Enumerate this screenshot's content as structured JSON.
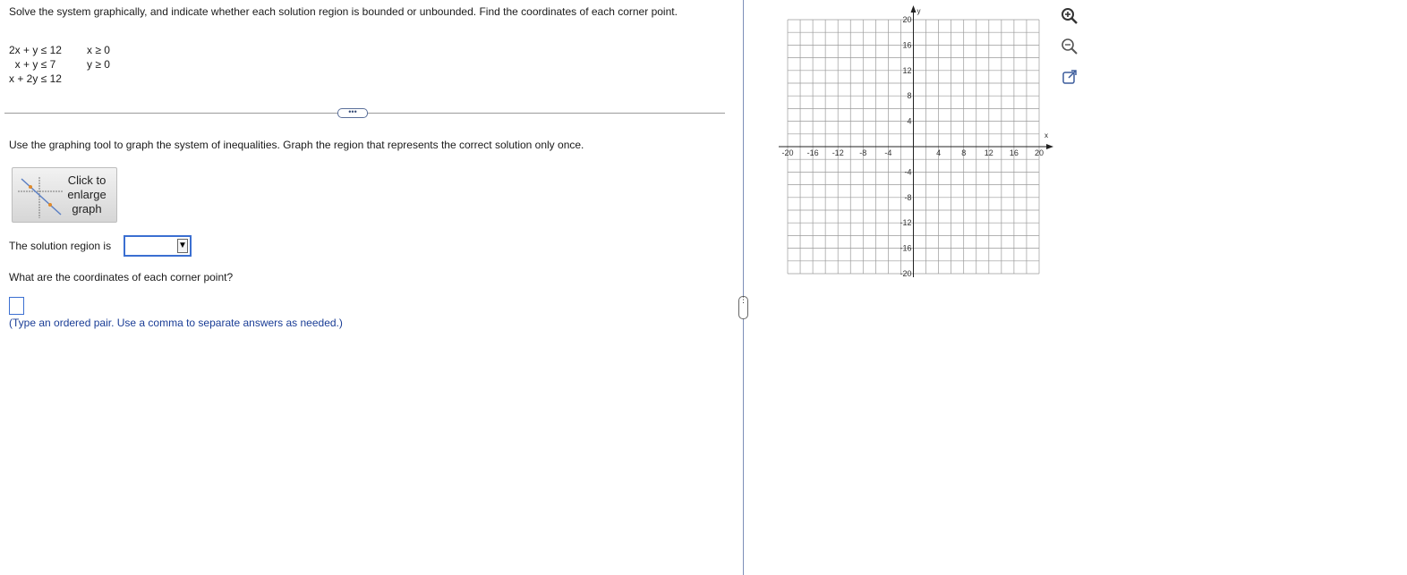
{
  "problem": {
    "prompt": "Solve the system graphically, and indicate whether each solution region is bounded or unbounded. Find the coordinates of each corner point.",
    "inequalities_left": [
      "2x + y ≤ 12",
      "x + y ≤ 7",
      "x + 2y ≤ 12"
    ],
    "inequalities_right": [
      "x ≥ 0",
      "y ≥ 0"
    ]
  },
  "toolbar": {
    "more_label": "•••"
  },
  "instructions": "Use the graphing tool to graph the system of inequalities. Graph the region that represents the correct solution only once.",
  "enlarge_button": {
    "line1": "Click to",
    "line2": "enlarge",
    "line3": "graph"
  },
  "solution_region": {
    "label": "The solution region is",
    "selected": ""
  },
  "corner_points": {
    "question": "What are the coordinates of each corner point?",
    "answer": "",
    "hint": "(Type an ordered pair. Use a comma to separate answers as needed.)"
  },
  "pane_handle": "⋮",
  "graph": {
    "x_label": "x",
    "y_label": "y",
    "x_ticks": [
      "-20",
      "-16",
      "-12",
      "-8",
      "-4",
      "4",
      "8",
      "12",
      "16",
      "20"
    ],
    "y_ticks": [
      "20",
      "16",
      "12",
      "8",
      "4",
      "-4",
      "-8",
      "-12",
      "-16",
      "-20"
    ],
    "range": [
      -20,
      20
    ],
    "grid_step": 2
  },
  "tools": [
    "zoom-in-icon",
    "zoom-out-icon",
    "popout-icon"
  ],
  "colors": {
    "accent": "#3b6fd1",
    "hint_text": "#1a3d96",
    "grid": "#9a9a9a"
  }
}
